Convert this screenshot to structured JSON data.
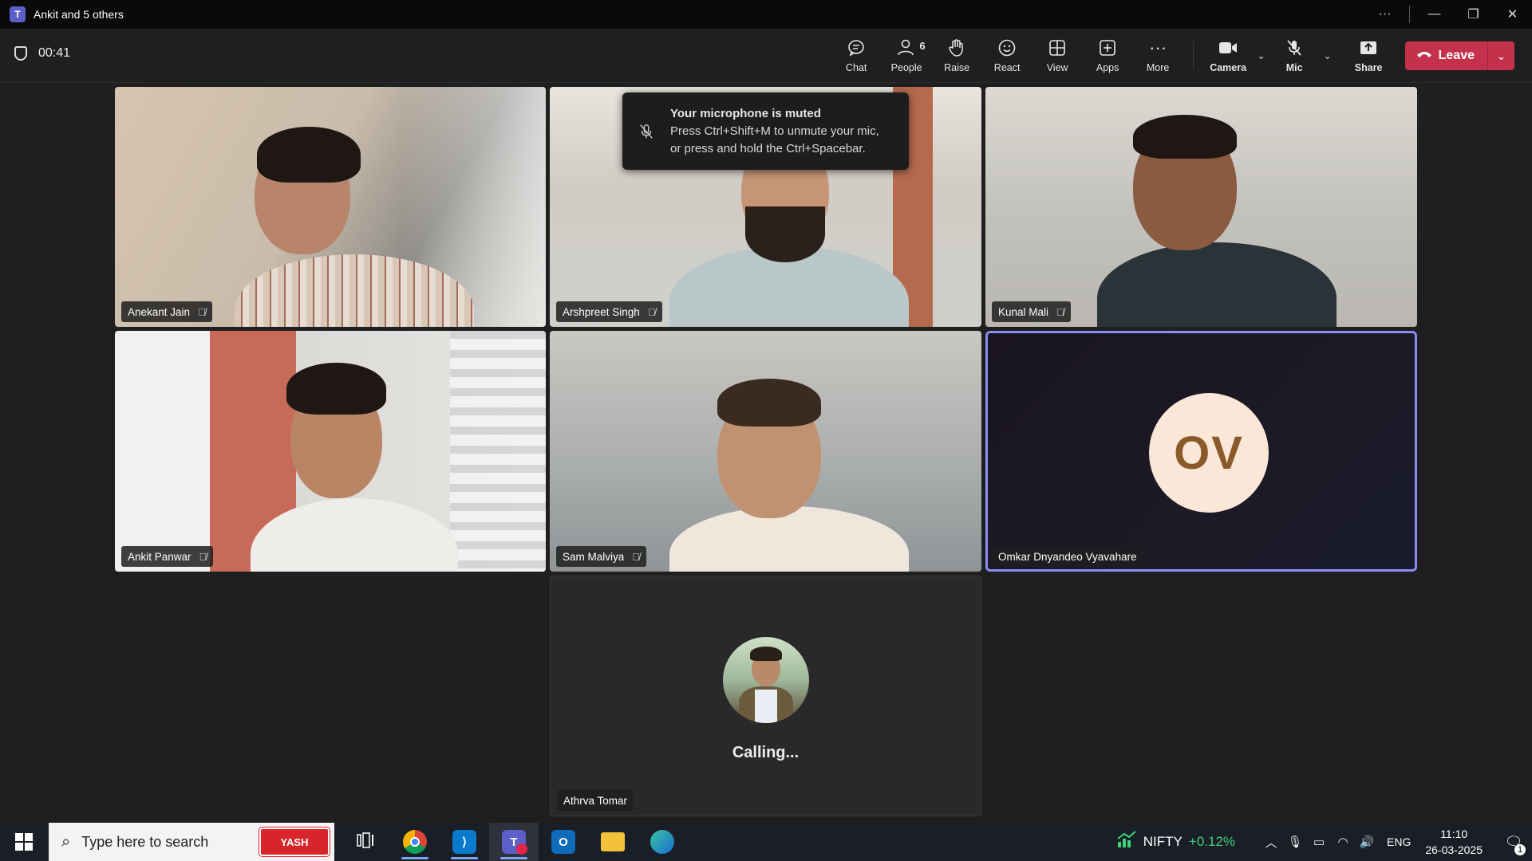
{
  "window": {
    "title": "Ankit and 5 others"
  },
  "meeting": {
    "timer": "00:41"
  },
  "toolbar": {
    "chat": "Chat",
    "people": "People",
    "people_count": "6",
    "raise": "Raise",
    "react": "React",
    "view": "View",
    "apps": "Apps",
    "more": "More",
    "camera": "Camera",
    "mic": "Mic",
    "share": "Share",
    "leave": "Leave"
  },
  "toast": {
    "title": "Your microphone is muted",
    "line1": "Press Ctrl+Shift+M to unmute your mic,",
    "line2": "or press and hold the Ctrl+Spacebar."
  },
  "participants": [
    {
      "name": "Anekant Jain",
      "muted": true
    },
    {
      "name": "Arshpreet Singh",
      "muted": true
    },
    {
      "name": "Kunal Mali",
      "muted": true
    },
    {
      "name": "Ankit Panwar",
      "muted": true
    },
    {
      "name": "Sam Malviya",
      "muted": true
    },
    {
      "name": "Omkar Dnyandeo Vyavahare",
      "initials": "OV"
    },
    {
      "name": "Athrva Tomar",
      "status": "Calling..."
    }
  ],
  "taskbar": {
    "search_placeholder": "Type here to search",
    "search_badge": "YASH",
    "nifty_label": "NIFTY",
    "nifty_change": "+0.12%",
    "language": "ENG",
    "time": "11:10",
    "date": "26-03-2025",
    "notification_count": "1"
  },
  "colors": {
    "leave": "#c4314b",
    "active_speaker_border": "#8b8cf5",
    "ov_avatar_bg": "#fbe7d8",
    "ov_avatar_text": "#8a5a2b",
    "nifty_green": "#3fd37a"
  }
}
